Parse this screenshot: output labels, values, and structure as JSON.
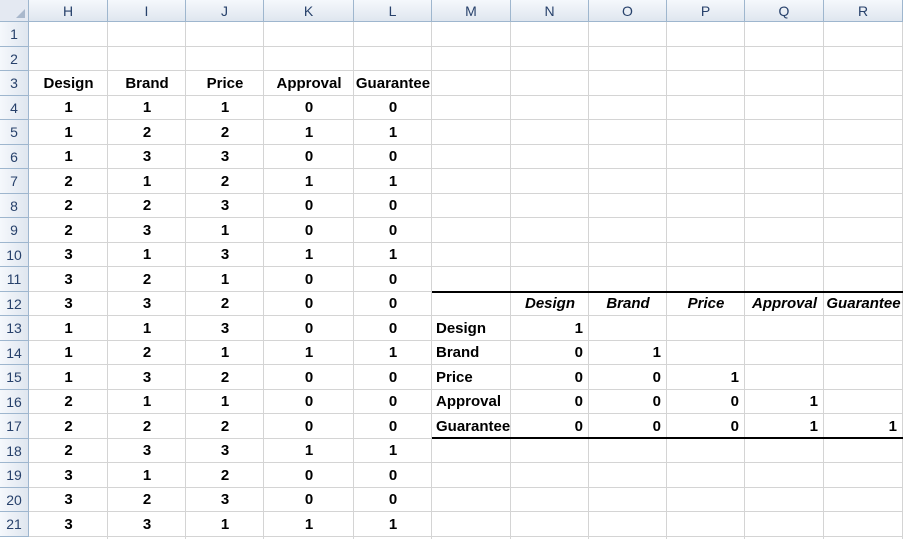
{
  "columns": [
    "H",
    "I",
    "J",
    "K",
    "L",
    "M",
    "N",
    "O",
    "P",
    "Q",
    "R"
  ],
  "rows": [
    "1",
    "2",
    "3",
    "4",
    "5",
    "6",
    "7",
    "8",
    "9",
    "10",
    "11",
    "12",
    "13",
    "14",
    "15",
    "16",
    "17",
    "18",
    "19",
    "20",
    "21"
  ],
  "data_headers": [
    "Design",
    "Brand",
    "Price",
    "Approval",
    "Guarantee"
  ],
  "data_rows": [
    [
      "1",
      "1",
      "1",
      "0",
      "0"
    ],
    [
      "1",
      "2",
      "2",
      "1",
      "1"
    ],
    [
      "1",
      "3",
      "3",
      "0",
      "0"
    ],
    [
      "2",
      "1",
      "2",
      "1",
      "1"
    ],
    [
      "2",
      "2",
      "3",
      "0",
      "0"
    ],
    [
      "2",
      "3",
      "1",
      "0",
      "0"
    ],
    [
      "3",
      "1",
      "3",
      "1",
      "1"
    ],
    [
      "3",
      "2",
      "1",
      "0",
      "0"
    ],
    [
      "3",
      "3",
      "2",
      "0",
      "0"
    ],
    [
      "1",
      "1",
      "3",
      "0",
      "0"
    ],
    [
      "1",
      "2",
      "1",
      "1",
      "1"
    ],
    [
      "1",
      "3",
      "2",
      "0",
      "0"
    ],
    [
      "2",
      "1",
      "1",
      "0",
      "0"
    ],
    [
      "2",
      "2",
      "2",
      "0",
      "0"
    ],
    [
      "2",
      "3",
      "3",
      "1",
      "1"
    ],
    [
      "3",
      "1",
      "2",
      "0",
      "0"
    ],
    [
      "3",
      "2",
      "3",
      "0",
      "0"
    ],
    [
      "3",
      "3",
      "1",
      "1",
      "1"
    ]
  ],
  "corr_headers": [
    "Design",
    "Brand",
    "Price",
    "Approval",
    "Guarantee"
  ],
  "corr_row_labels": [
    "Design",
    "Brand",
    "Price",
    "Approval",
    "Guarantee"
  ],
  "corr_values": [
    [
      "1"
    ],
    [
      "0",
      "1"
    ],
    [
      "0",
      "0",
      "1"
    ],
    [
      "0",
      "0",
      "0",
      "1"
    ],
    [
      "0",
      "0",
      "0",
      "1",
      "1"
    ]
  ],
  "colors": {
    "header_text": "#27416b",
    "header_border": "#9eb6ce",
    "grid": "#d4d4d4"
  }
}
